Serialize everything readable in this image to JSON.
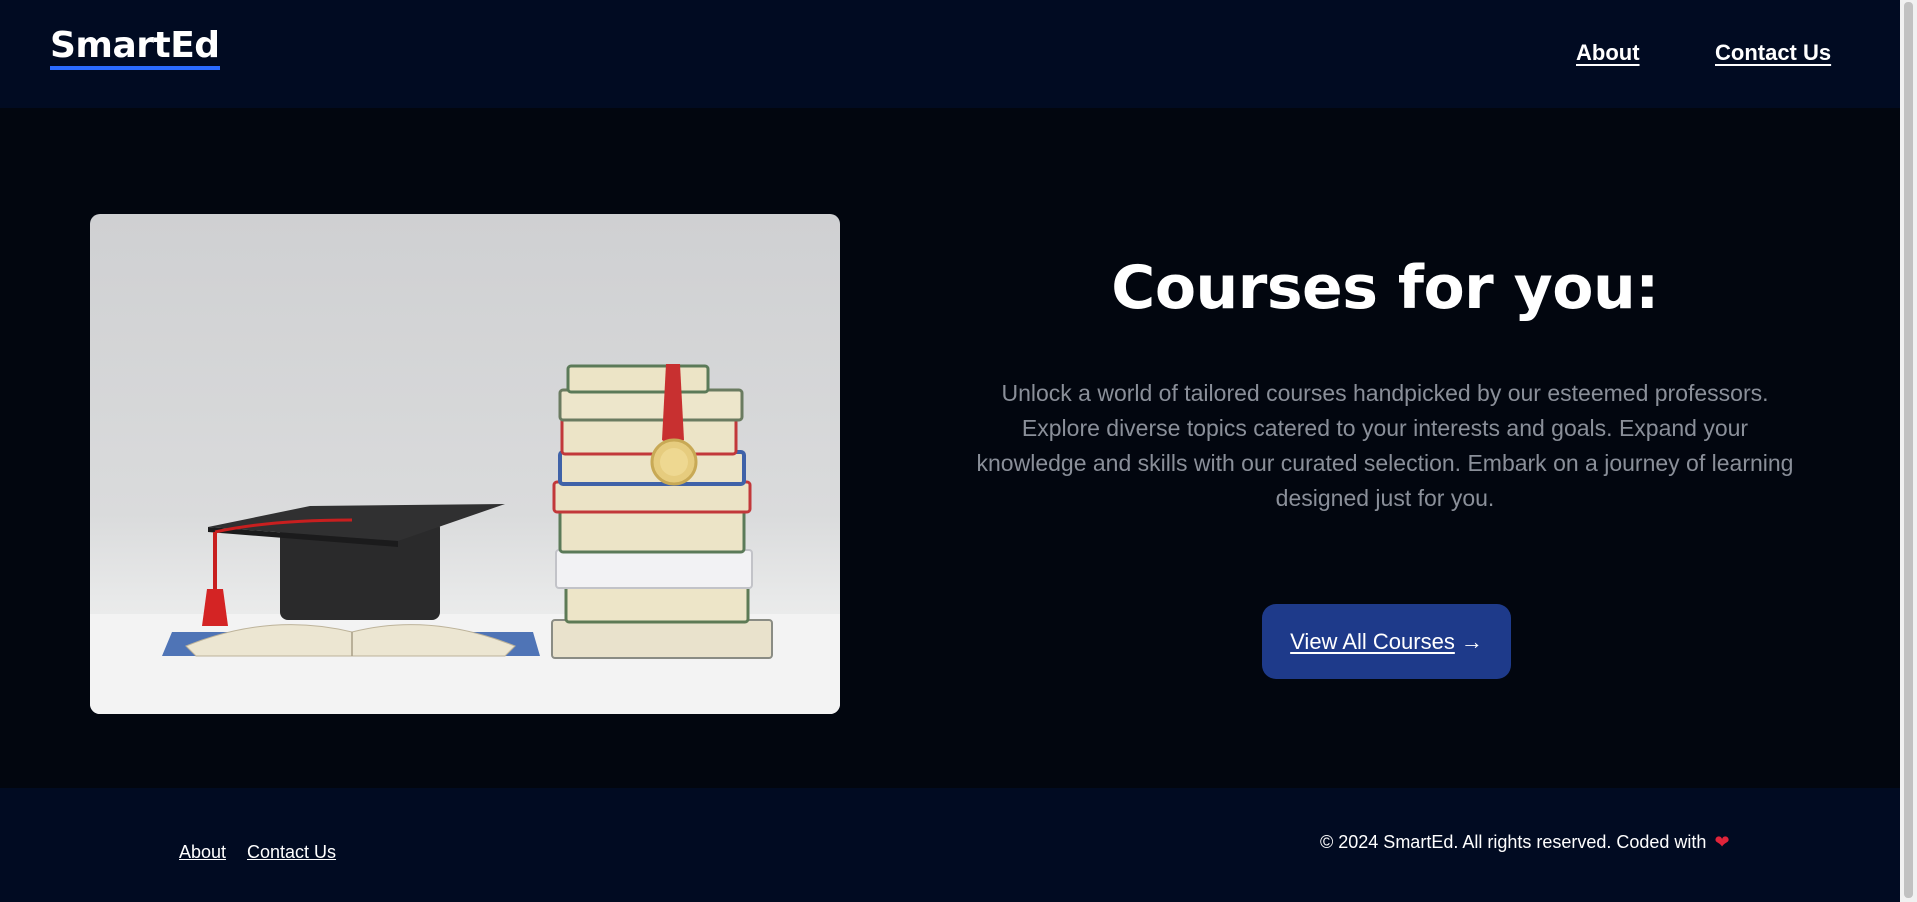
{
  "header": {
    "logo": "SmartEd",
    "nav": {
      "about": "About",
      "contact": "Contact Us"
    }
  },
  "hero": {
    "title": "Courses for you:",
    "description": "Unlock a world of tailored courses handpicked by our esteemed professors. Explore diverse topics catered to your interests and goals. Expand your knowledge and skills with our curated selection. Embark on a journey of learning designed just for you.",
    "cta_label": "View All Courses",
    "cta_icon": "→",
    "image_alt": "graduation-cap-and-books-photo"
  },
  "footer": {
    "about": "About",
    "contact": "Contact Us",
    "copyright": "© 2024 SmartEd. All rights reserved. Coded with",
    "heart": "❤"
  },
  "colors": {
    "header_bg": "#010b22",
    "body_bg": "#02060f",
    "accent": "#1e3a8a",
    "logo_underline": "#2b6bff",
    "heart": "#e0243a"
  }
}
